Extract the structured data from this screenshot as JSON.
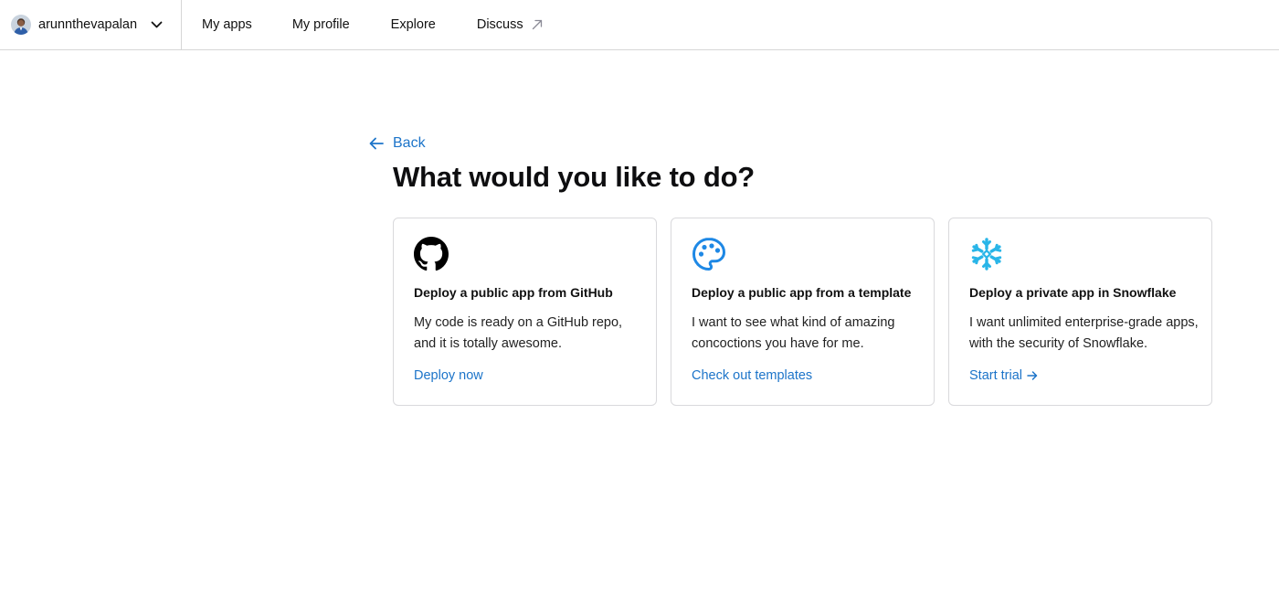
{
  "nav": {
    "username": "arunnthevapalan",
    "links": {
      "my_apps": "My apps",
      "my_profile": "My profile",
      "explore": "Explore",
      "discuss": "Discuss"
    }
  },
  "main": {
    "back_label": "Back",
    "title": "What would you like to do?",
    "cards": [
      {
        "icon": "github-icon",
        "title": "Deploy a public app from GitHub",
        "description": "My code is ready on a GitHub repo, and it is totally awesome.",
        "link": "Deploy now"
      },
      {
        "icon": "palette-icon",
        "title": "Deploy a public app from a template",
        "description": "I want to see what kind of amazing concoctions you have for me.",
        "link": "Check out templates"
      },
      {
        "icon": "snowflake-icon",
        "title": "Deploy a private app in Snowflake",
        "description": "I want unlimited enterprise-grade apps, with the security of Snowflake.",
        "link": "Start trial"
      }
    ]
  },
  "colors": {
    "link_blue": "#1c74c9",
    "palette_blue": "#1e88e5",
    "snowflake_blue": "#29b5e8",
    "border": "#d9d9dc"
  }
}
